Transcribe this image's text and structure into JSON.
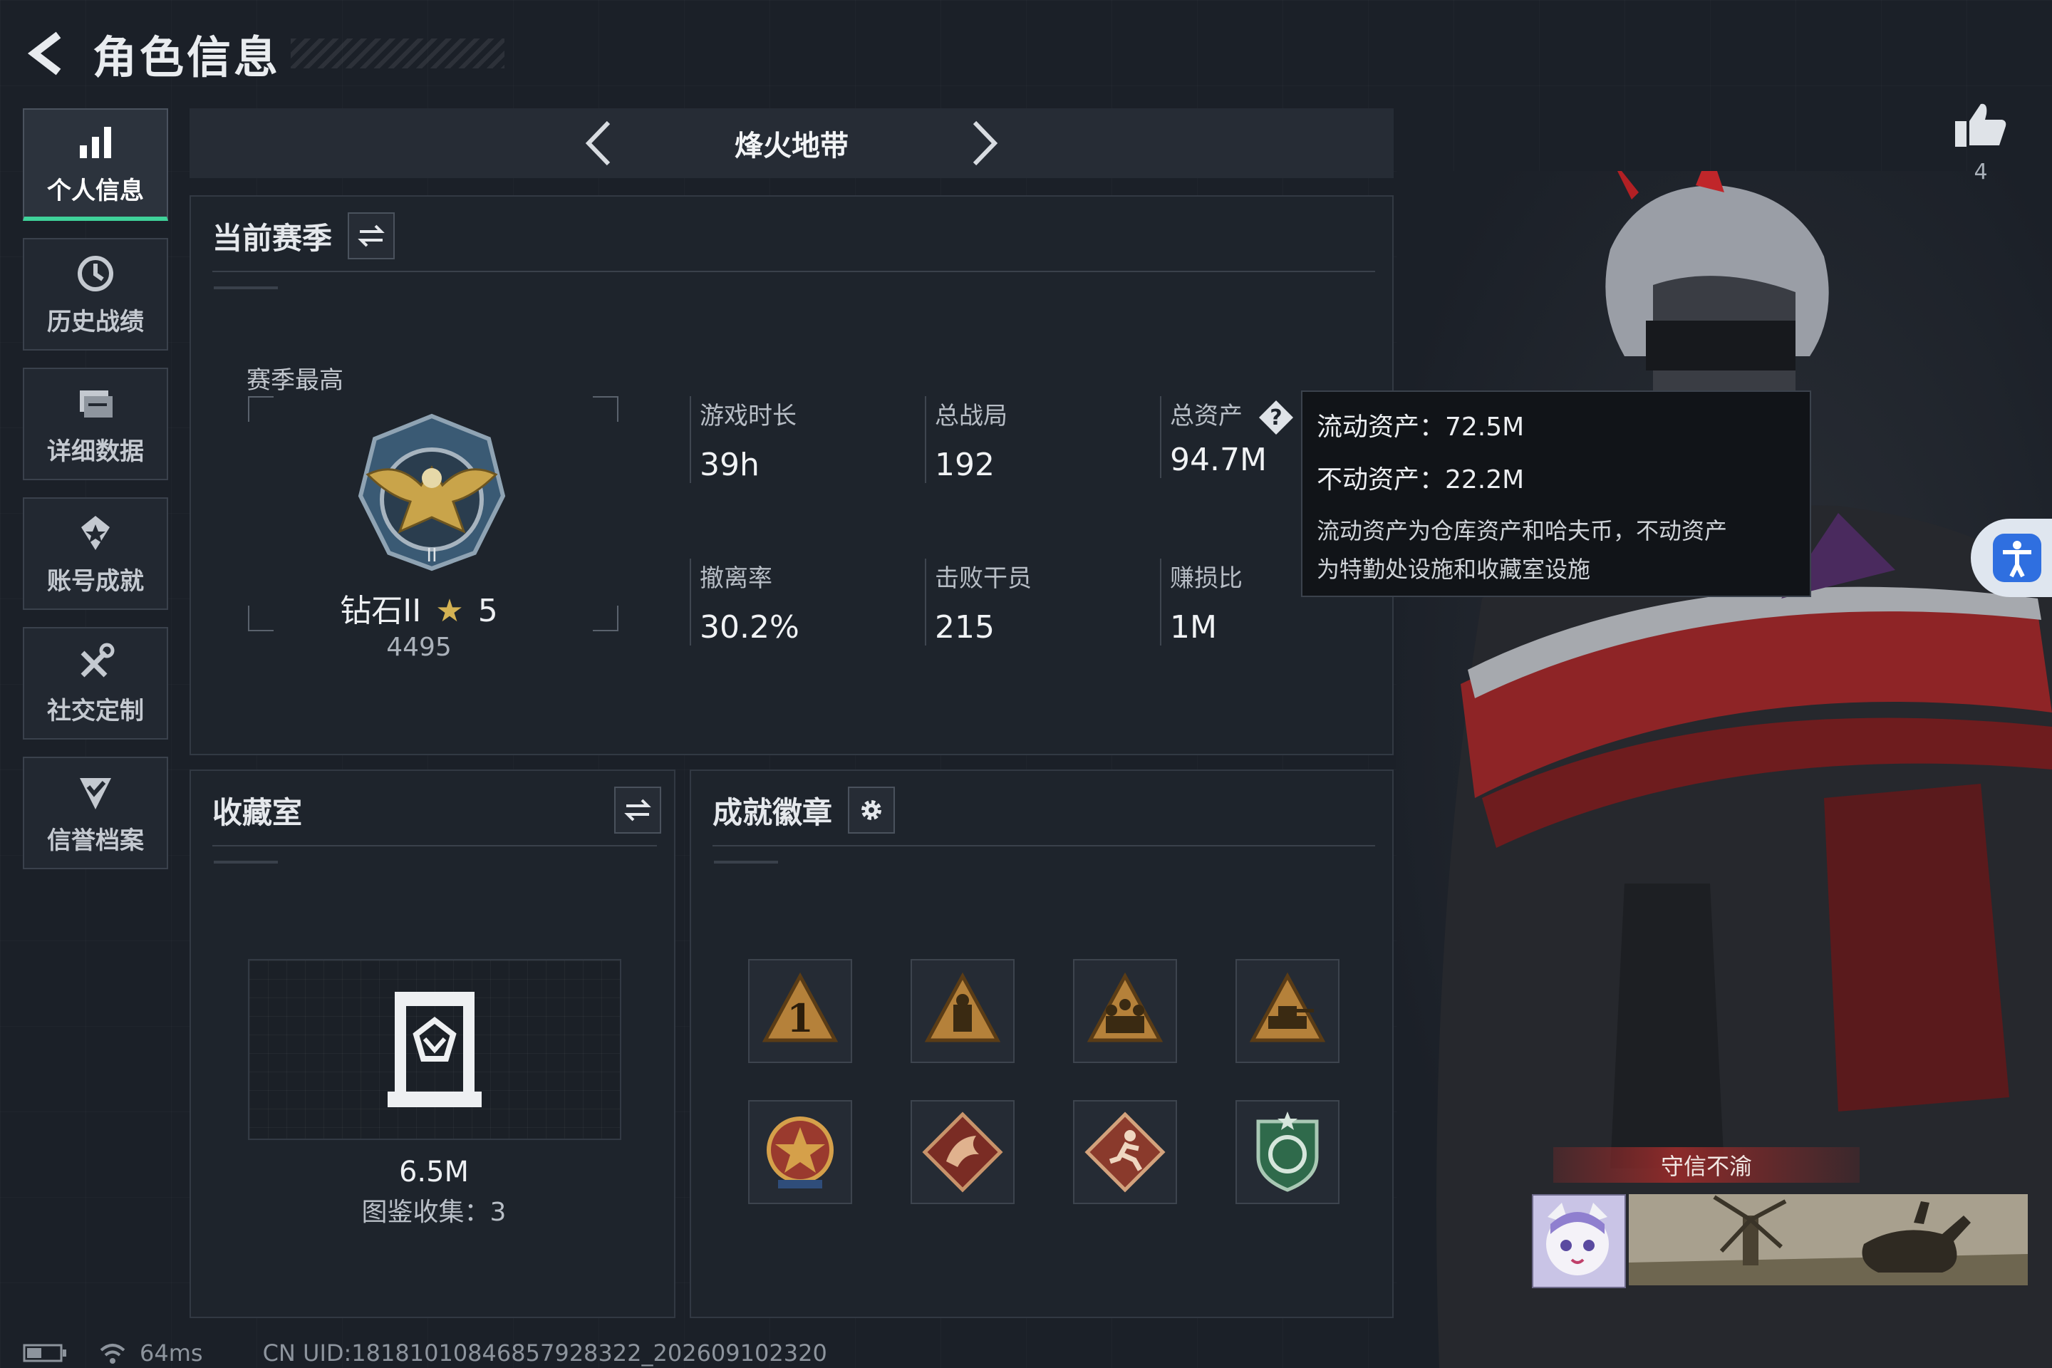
{
  "header": {
    "title": "角色信息"
  },
  "sidebar": {
    "items": [
      {
        "label": "个人信息",
        "icon": "bar-chart-icon",
        "active": true
      },
      {
        "label": "历史战绩",
        "icon": "history-clock-icon"
      },
      {
        "label": "详细数据",
        "icon": "folder-data-icon"
      },
      {
        "label": "账号成就",
        "icon": "achievement-icon"
      },
      {
        "label": "社交定制",
        "icon": "tools-icon"
      },
      {
        "label": "信誉档案",
        "icon": "shield-check-icon"
      }
    ]
  },
  "mode": {
    "title": "烽火地带"
  },
  "season": {
    "title": "当前赛季",
    "best_label": "赛季最高",
    "rank_name": "钻石II",
    "rank_stars": "5",
    "rank_score": "4495",
    "stats": [
      {
        "label": "游戏时长",
        "value": "39h"
      },
      {
        "label": "总战局",
        "value": "192"
      },
      {
        "label": "总资产",
        "value": "94.7M"
      },
      {
        "label": "撤离率",
        "value": "30.2%"
      },
      {
        "label": "击败干员",
        "value": "215"
      },
      {
        "label": "赚损比",
        "value": "1M"
      }
    ]
  },
  "tooltip": {
    "liquid": "流动资产：72.5M",
    "fixed": "不动资产：22.2M",
    "desc_line1": "流动资产为仓库资产和哈夫币，不动资产",
    "desc_line2": "为特勤处设施和收藏室设施"
  },
  "collection": {
    "title": "收藏室",
    "value": "6.5M",
    "count_text": "图鉴收集：3"
  },
  "badges": {
    "title": "成就徽章",
    "items": [
      "rank-one-triangle-badge",
      "soldier-triangle-badge",
      "squad-triangle-badge",
      "tank-triangle-badge",
      "star-medal-badge",
      "dragon-diamond-badge",
      "runner-diamond-badge",
      "green-shield-badge"
    ]
  },
  "character": {
    "likes": "4",
    "title_tag": "守信不渝"
  },
  "status": {
    "ping": "64ms",
    "uid": "CN UID:18181010846857928322_202609102320"
  },
  "colors": {
    "accent": "#3fd29a",
    "panel": "#1e242c",
    "tag_red": "#8c2a2a"
  }
}
